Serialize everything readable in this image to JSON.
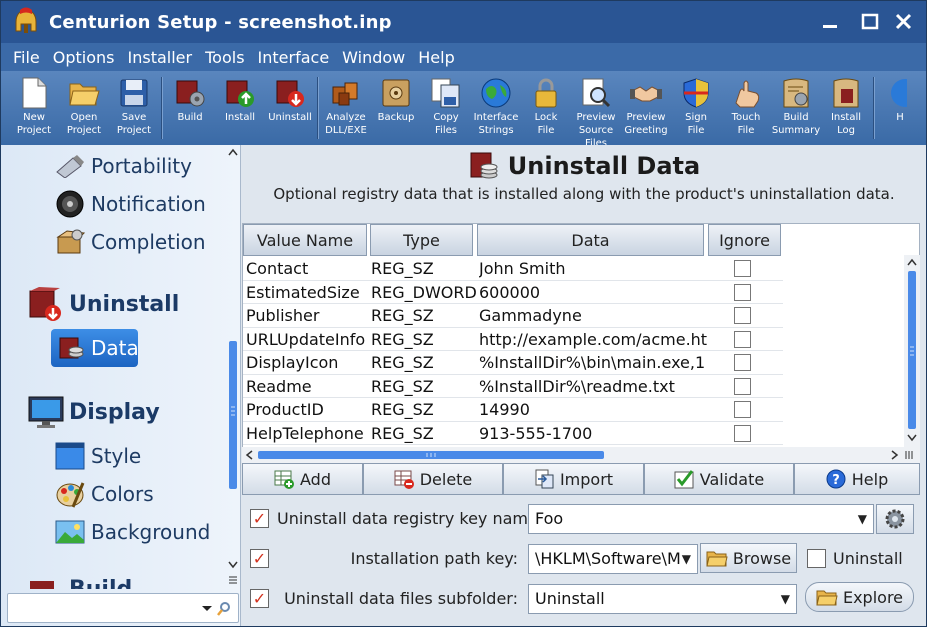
{
  "window": {
    "title": "Centurion Setup - screenshot.inp"
  },
  "menu": [
    "File",
    "Options",
    "Installer",
    "Tools",
    "Interface",
    "Window",
    "Help"
  ],
  "toolbar": [
    {
      "l1": "New",
      "l2": "Project"
    },
    {
      "l1": "Open",
      "l2": "Project"
    },
    {
      "l1": "Save",
      "l2": "Project"
    },
    {
      "l1": "",
      "l2": "Build"
    },
    {
      "l1": "",
      "l2": "Install"
    },
    {
      "l1": "",
      "l2": "Uninstall"
    },
    {
      "l1": "Analyze",
      "l2": "DLL/EXE"
    },
    {
      "l1": "",
      "l2": "Backup"
    },
    {
      "l1": "Copy",
      "l2": "Files"
    },
    {
      "l1": "Interface",
      "l2": "Strings"
    },
    {
      "l1": "Lock",
      "l2": "File"
    },
    {
      "l1": "Preview",
      "l2": "Source Files"
    },
    {
      "l1": "Preview",
      "l2": "Greeting"
    },
    {
      "l1": "Sign",
      "l2": "File"
    },
    {
      "l1": "Touch",
      "l2": "File"
    },
    {
      "l1": "Build",
      "l2": "Summary"
    },
    {
      "l1": "Install",
      "l2": "Log"
    },
    {
      "l1": "",
      "l2": "H"
    }
  ],
  "sidebar": {
    "portability": "Portability",
    "notification": "Notification",
    "completion": "Completion",
    "uninstall": "Uninstall",
    "data": "Data",
    "display": "Display",
    "style": "Style",
    "colors": "Colors",
    "background": "Background",
    "build": "Build"
  },
  "page": {
    "title": "Uninstall Data",
    "description": "Optional registry data that is installed along with the product's uninstallation data."
  },
  "grid": {
    "headers": [
      "Value Name",
      "Type",
      "Data",
      "Ignore"
    ],
    "rows": [
      {
        "name": "Contact",
        "type": "REG_SZ",
        "data": "John Smith"
      },
      {
        "name": "EstimatedSize",
        "type": "REG_DWORD",
        "data": "600000"
      },
      {
        "name": "Publisher",
        "type": "REG_SZ",
        "data": "Gammadyne"
      },
      {
        "name": "URLUpdateInfo",
        "type": "REG_SZ",
        "data": "http://example.com/acme.htm"
      },
      {
        "name": "DisplayIcon",
        "type": "REG_SZ",
        "data": "%InstallDir%\\bin\\main.exe,1"
      },
      {
        "name": "Readme",
        "type": "REG_SZ",
        "data": "%InstallDir%\\readme.txt"
      },
      {
        "name": "ProductID",
        "type": "REG_SZ",
        "data": "14990"
      },
      {
        "name": "HelpTelephone",
        "type": "REG_SZ",
        "data": "913-555-1700"
      }
    ]
  },
  "buttons": {
    "add": "Add",
    "delete": "Delete",
    "import": "Import",
    "validate": "Validate",
    "help": "Help"
  },
  "options": {
    "keyname_label": "Uninstall data registry key name:",
    "keyname_value": "Foo",
    "pathkey_label": "Installation path key:",
    "pathkey_value": "\\HKLM\\Software\\M",
    "browse": "Browse",
    "uninstall_chk": "Uninstall",
    "subfolder_label": "Uninstall data files subfolder:",
    "subfolder_value": "Uninstall",
    "explore": "Explore"
  }
}
